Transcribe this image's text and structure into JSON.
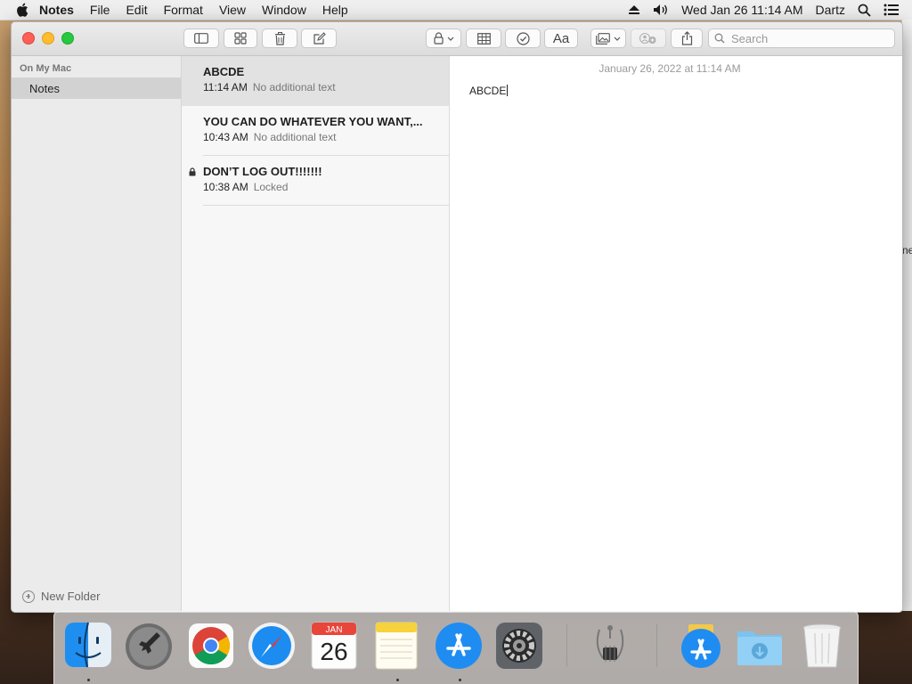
{
  "menubar": {
    "app_name": "Notes",
    "menus": [
      "File",
      "Edit",
      "Format",
      "View",
      "Window",
      "Help"
    ],
    "datetime": "Wed Jan 26  11:14 AM",
    "user": "Dartz",
    "icons": [
      "apple-icon",
      "eject-icon",
      "volume-icon",
      "spotlight-icon",
      "control-center-icon"
    ]
  },
  "desktop": {
    "clipped_text": "ne"
  },
  "toolbar": {
    "search_placeholder": "Search",
    "format_label": "Aa"
  },
  "sidebar": {
    "section": "On My Mac",
    "folders": [
      {
        "label": "Notes",
        "selected": true
      }
    ],
    "new_folder_label": "New Folder"
  },
  "notes": [
    {
      "title": "ABCDE",
      "time": "11:14 AM",
      "preview": "No additional text",
      "locked": false,
      "selected": true
    },
    {
      "title": "YOU CAN DO WHATEVER YOU WANT,...",
      "time": "10:43 AM",
      "preview": "No additional text",
      "locked": false,
      "selected": false
    },
    {
      "title": "DON’T LOG OUT!!!!!!!",
      "time": "10:38 AM",
      "preview": "Locked",
      "locked": true,
      "selected": false
    }
  ],
  "editor": {
    "date": "January 26, 2022 at 11:14 AM",
    "body": "ABCDE"
  },
  "dock": {
    "apps": [
      "Finder",
      "Launchpad",
      "Google Chrome",
      "Safari",
      "Calendar",
      "Notes",
      "App Store",
      "System Preferences",
      "System Information",
      "App Store Installer",
      "Downloads",
      "Trash"
    ],
    "calendar_month": "JAN",
    "calendar_day": "26"
  }
}
